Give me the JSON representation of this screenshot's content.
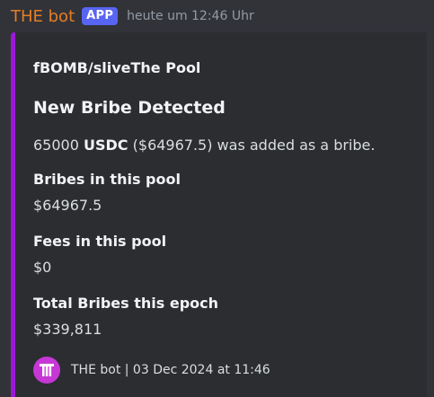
{
  "message": {
    "username": "THE bot",
    "badge": "APP",
    "timestamp": "heute um 12:46 Uhr",
    "username_color": "#e67e22",
    "badge_color": "#5865f2"
  },
  "embed": {
    "accent_color": "#9b18d8",
    "author": "fBOMB/sliveThe Pool",
    "title": "New Bribe Detected",
    "description": {
      "amount": "65000",
      "token": "USDC",
      "rest": "($64967.5) was added as a bribe."
    },
    "fields": [
      {
        "name": "Bribes in this pool",
        "value": "$64967.5"
      },
      {
        "name": "Fees in this pool",
        "value": "$0"
      },
      {
        "name": "Total Bribes this epoch",
        "value": "$339,811"
      }
    ],
    "footer": {
      "icon": "the-logo-icon",
      "text": "THE bot | 03 Dec 2024 at 11:46"
    }
  }
}
